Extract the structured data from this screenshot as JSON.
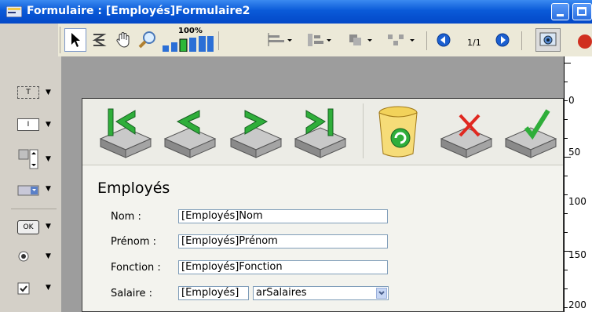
{
  "window": {
    "title": "Formulaire : [Employés]Formulaire2"
  },
  "toolbar": {
    "zoom_label": "100%",
    "page_indicator": "1/1"
  },
  "form": {
    "title": "Employés",
    "fields": [
      {
        "label": "Nom :",
        "value": "[Employés]Nom"
      },
      {
        "label": "Prénom :",
        "value": "[Employés]Prénom"
      },
      {
        "label": "Fonction :",
        "value": "[Employés]Fonction"
      },
      {
        "label": "Salaire :",
        "value": "[Employés]",
        "select_value": "arSalaires"
      }
    ]
  },
  "palette": {
    "text_icon_label": "T",
    "input_icon_label": "I",
    "ok_label": "OK"
  },
  "ruler": {
    "labels": [
      "0",
      "50",
      "100",
      "150",
      "200"
    ]
  },
  "colors": {
    "titlebar": "#0a5ad8",
    "form_bg": "#f3f3ee",
    "canvas_bg": "#9d9d9d"
  },
  "icons": [
    "pointer-icon",
    "autonumber-icon",
    "hand-icon",
    "zoom-icon",
    "zoom-level-icon",
    "align-icon",
    "distribute-icon",
    "layer-icon",
    "group-icon",
    "prev-page-icon",
    "next-page-icon",
    "preview-icon",
    "first-record-icon",
    "previous-record-icon",
    "next-record-icon",
    "last-record-icon",
    "delete-record-icon",
    "cancel-icon",
    "accept-icon"
  ]
}
